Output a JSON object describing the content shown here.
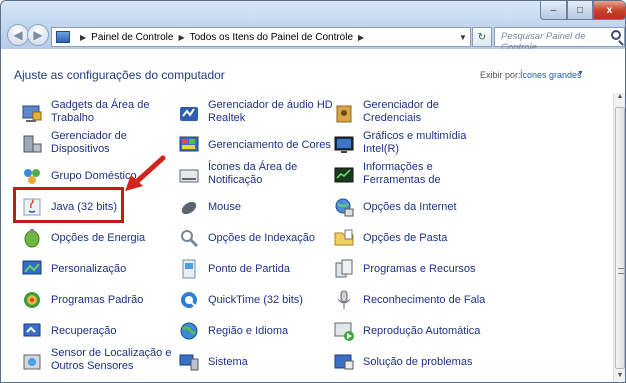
{
  "window": {
    "controls": {
      "minimize": "–",
      "maximize": "□",
      "close": "x"
    }
  },
  "address": {
    "segments": [
      "Painel de Controle",
      "Todos os Itens do Painel de Controle"
    ],
    "search_placeholder": "Pesquisar Painel de Controle"
  },
  "header": {
    "title": "Ajuste as configurações do computador",
    "viewby_label": "Exibir por:",
    "viewby_value": "Ícones grandes"
  },
  "items": [
    {
      "label1": "Gadgets da Área de",
      "label2": "Trabalho",
      "icon": "gadgets-icon"
    },
    {
      "label1": "Gerenciador de áudio HD",
      "label2": "Realtek",
      "icon": "realtek-audio-icon"
    },
    {
      "label1": "Gerenciador de",
      "label2": "Credenciais",
      "icon": "credential-manager-icon"
    },
    {
      "label1": "Gerenciador de",
      "label2": "Dispositivos",
      "icon": "device-manager-icon"
    },
    {
      "label1": "Gerenciamento de Cores",
      "label2": "",
      "icon": "color-management-icon"
    },
    {
      "label1": "Gráficos e multimídia",
      "label2": "Intel(R)",
      "icon": "intel-graphics-icon"
    },
    {
      "label1": "Grupo Doméstico",
      "label2": "",
      "icon": "homegroup-icon"
    },
    {
      "label1": "Ícones da Área de",
      "label2": "Notificação",
      "icon": "notification-icons-icon"
    },
    {
      "label1": "Informações e",
      "label2": "Ferramentas de",
      "icon": "performance-info-icon"
    },
    {
      "label1": "Java (32 bits)",
      "label2": "",
      "icon": "java-icon"
    },
    {
      "label1": "Mouse",
      "label2": "",
      "icon": "mouse-icon"
    },
    {
      "label1": "Opções da Internet",
      "label2": "",
      "icon": "internet-options-icon"
    },
    {
      "label1": "Opções de Energia",
      "label2": "",
      "icon": "power-options-icon"
    },
    {
      "label1": "Opções de Indexação",
      "label2": "",
      "icon": "indexing-options-icon"
    },
    {
      "label1": "Opções de Pasta",
      "label2": "",
      "icon": "folder-options-icon"
    },
    {
      "label1": "Personalização",
      "label2": "",
      "icon": "personalization-icon"
    },
    {
      "label1": "Ponto de Partida",
      "label2": "",
      "icon": "getting-started-icon"
    },
    {
      "label1": "Programas e Recursos",
      "label2": "",
      "icon": "programs-features-icon"
    },
    {
      "label1": "Programas Padrão",
      "label2": "",
      "icon": "default-programs-icon"
    },
    {
      "label1": "QuickTime (32 bits)",
      "label2": "",
      "icon": "quicktime-icon"
    },
    {
      "label1": "Reconhecimento de Fala",
      "label2": "",
      "icon": "speech-recognition-icon"
    },
    {
      "label1": "Recuperação",
      "label2": "",
      "icon": "recovery-icon"
    },
    {
      "label1": "Região e Idioma",
      "label2": "",
      "icon": "region-language-icon"
    },
    {
      "label1": "Reprodução Automática",
      "label2": "",
      "icon": "autoplay-icon"
    },
    {
      "label1": "Sensor de Localização e",
      "label2": "Outros Sensores",
      "icon": "location-sensors-icon"
    },
    {
      "label1": "Sistema",
      "label2": "",
      "icon": "system-icon"
    },
    {
      "label1": "Solução de problemas",
      "label2": "",
      "icon": "troubleshooting-icon"
    }
  ]
}
